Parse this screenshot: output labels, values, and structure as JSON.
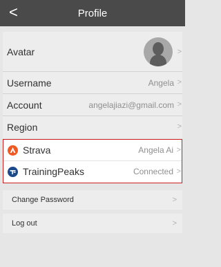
{
  "nav": {
    "back_glyph": "<",
    "title": "Profile"
  },
  "profile": {
    "avatar_label": "Avatar",
    "username_label": "Username",
    "username_value": "Angela",
    "account_label": "Account",
    "account_value": "angelajiazi@gmail.com",
    "region_label": "Region",
    "region_value": ""
  },
  "linked_services": [
    {
      "name": "Strava",
      "value": "Angela Ai",
      "icon": "strava-icon",
      "color": "#f05a22"
    },
    {
      "name": "TrainingPeaks",
      "value": "Connected",
      "icon": "trainingpeaks-icon",
      "color": "#1b4a8c"
    }
  ],
  "actions": {
    "change_password": "Change Password",
    "log_out": "Log out"
  },
  "chevron_glyph": ">",
  "colors": {
    "nav_bar": "#4a4a4a",
    "highlight_border": "#c91c1c",
    "background": "#e6e6e6"
  }
}
